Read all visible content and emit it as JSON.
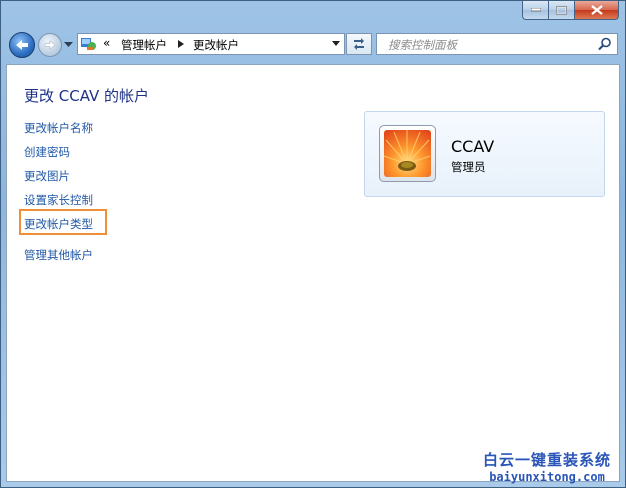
{
  "window": {
    "caption": {
      "minimize": "minimize-icon",
      "maximize": "maximize-icon",
      "close": "close-icon"
    }
  },
  "navbar": {
    "address": {
      "overflow": "«",
      "crumbs": [
        "管理帐户",
        "更改帐户"
      ]
    },
    "search": {
      "placeholder": "搜索控制面板"
    }
  },
  "page": {
    "title": "更改 CCAV 的帐户",
    "links": [
      "更改帐户名称",
      "创建密码",
      "更改图片",
      "设置家长控制",
      "更改帐户类型",
      "管理其他帐户"
    ],
    "highlighted_link_index": 4
  },
  "account": {
    "name": "CCAV",
    "role": "管理员"
  },
  "watermark": {
    "cn": "白云一键重装系统",
    "en": "baiyunxitong.com"
  },
  "colors": {
    "link": "#1f58a7",
    "title": "#1e3287",
    "highlight": "#f08e3a"
  }
}
